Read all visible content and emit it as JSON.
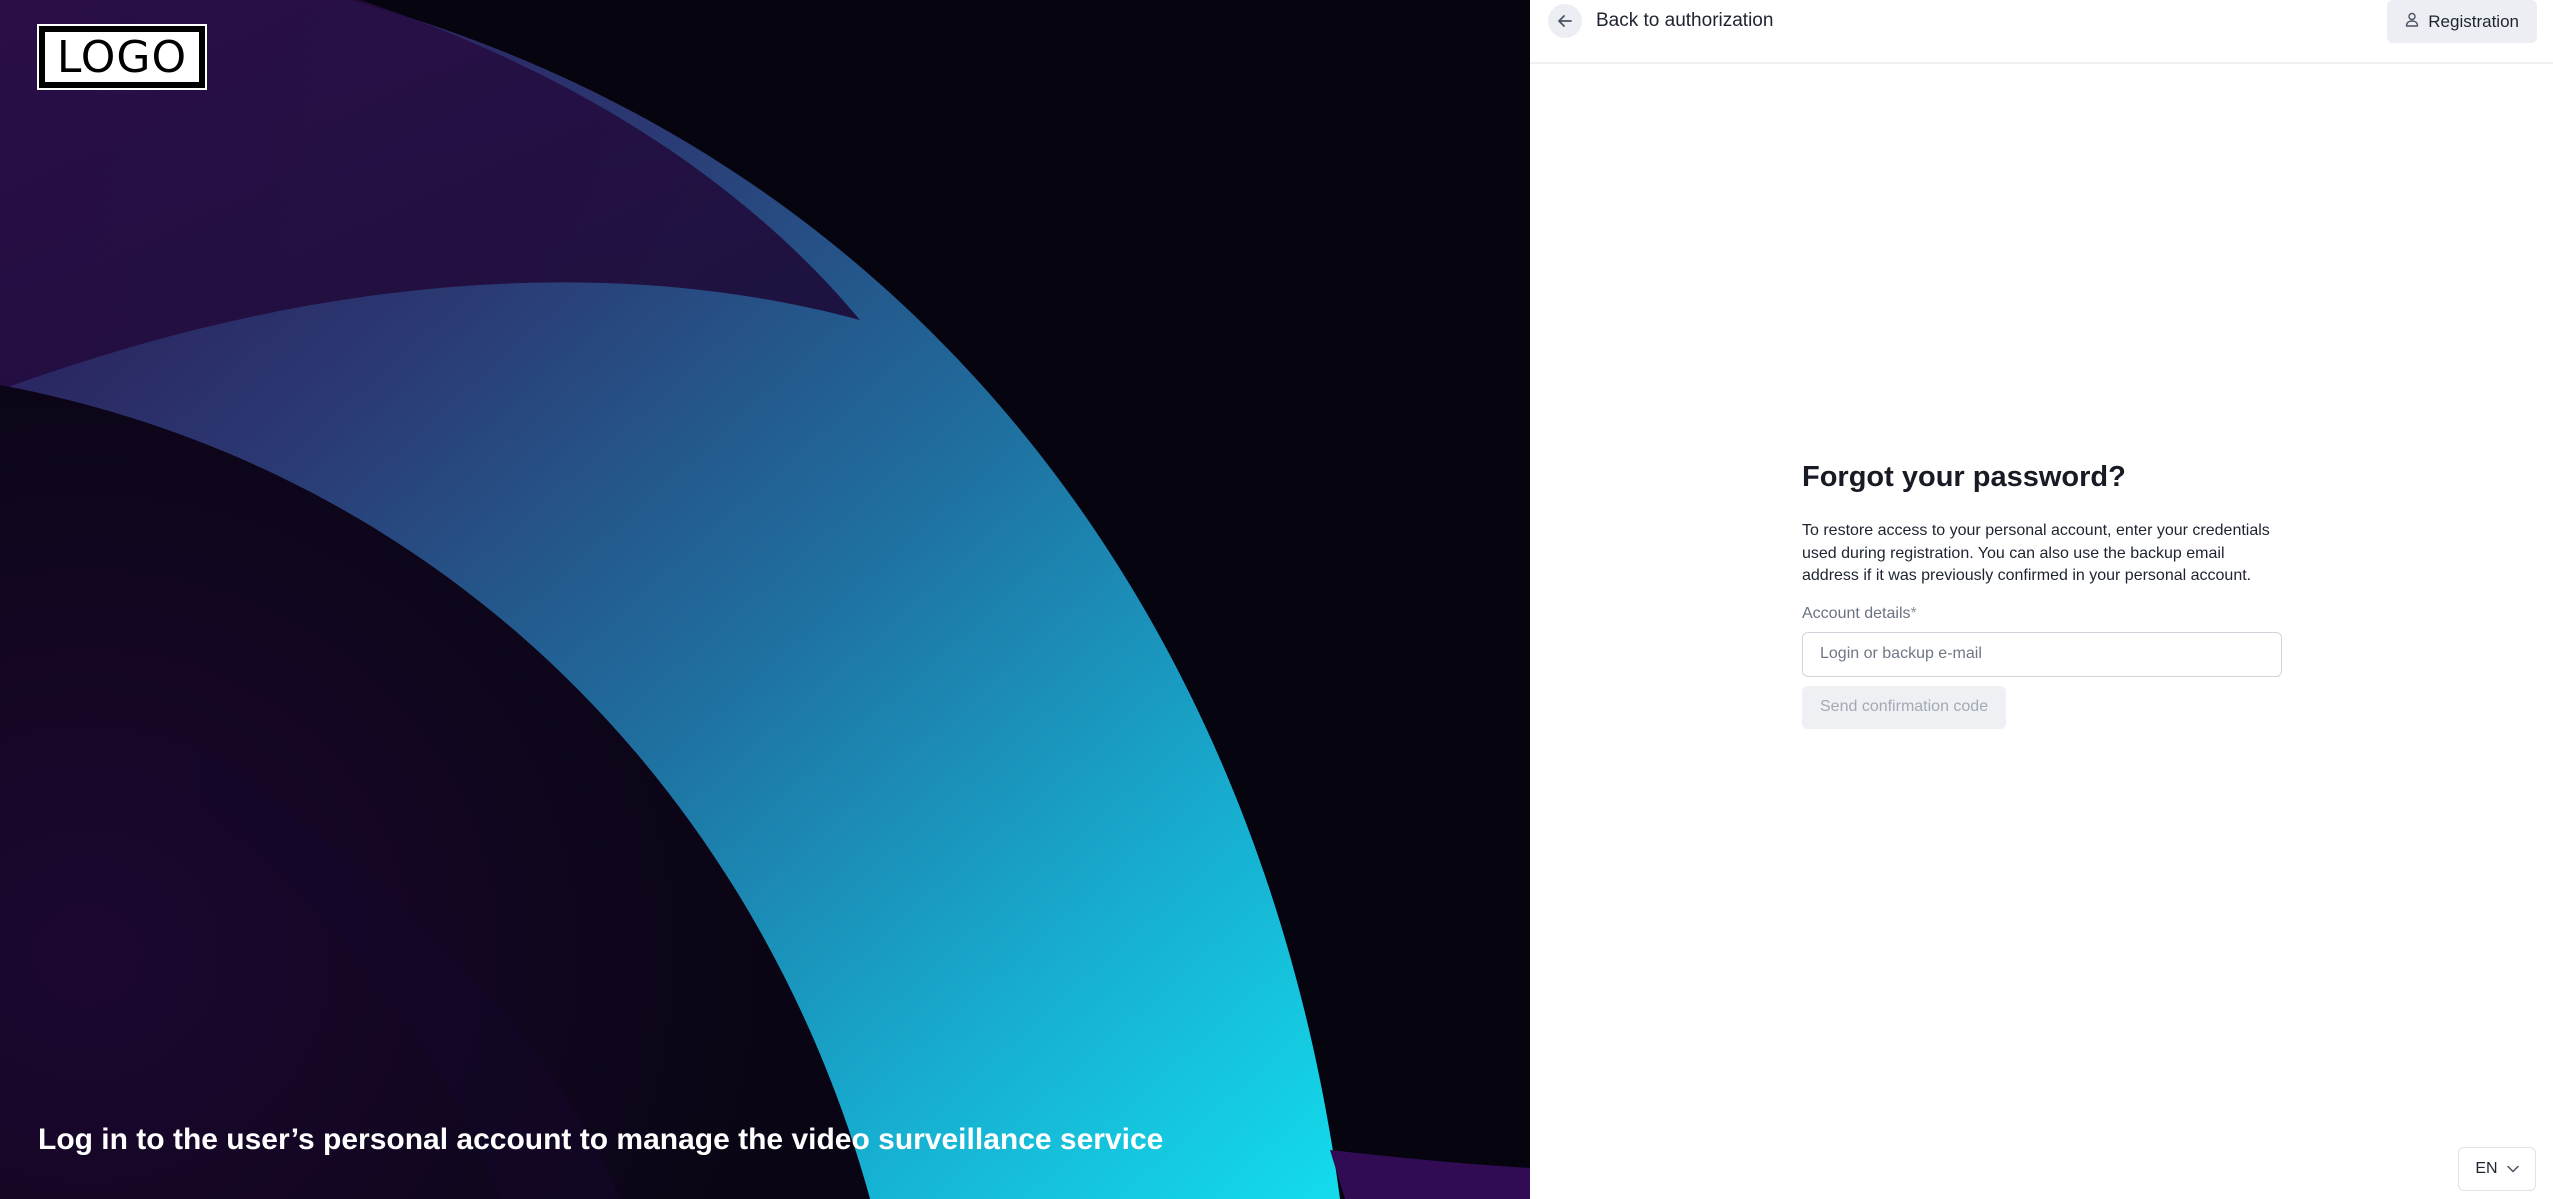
{
  "hero": {
    "logo_text": "LOGO",
    "caption": "Log in to the user’s personal account to manage the video surveillance service"
  },
  "topbar": {
    "back_label": "Back to authorization",
    "registration_label": "Registration"
  },
  "form": {
    "title": "Forgot your password?",
    "description": "To restore access to your personal account, enter your credentials used during registration. You can also use the backup email address if it was previously confirmed in your personal account.",
    "field_label": "Account details",
    "required_marker": "*",
    "input_value": "",
    "input_placeholder": "Login or backup e-mail",
    "submit_label": "Send confirmation code"
  },
  "language": {
    "selected": "EN"
  },
  "icons": {
    "back": "arrow-left-icon",
    "registration": "user-icon",
    "language_dropdown": "chevron-down-icon"
  },
  "colors": {
    "hero_dark": "#06040f",
    "hero_purple": "#2a0f4a",
    "hero_cyan": "#13d8ea",
    "hero_blue": "#2c5a9a",
    "panel_bg": "#ffffff",
    "button_bg": "#eceef3",
    "text_primary": "#161b24",
    "text_muted": "#6b7383"
  }
}
